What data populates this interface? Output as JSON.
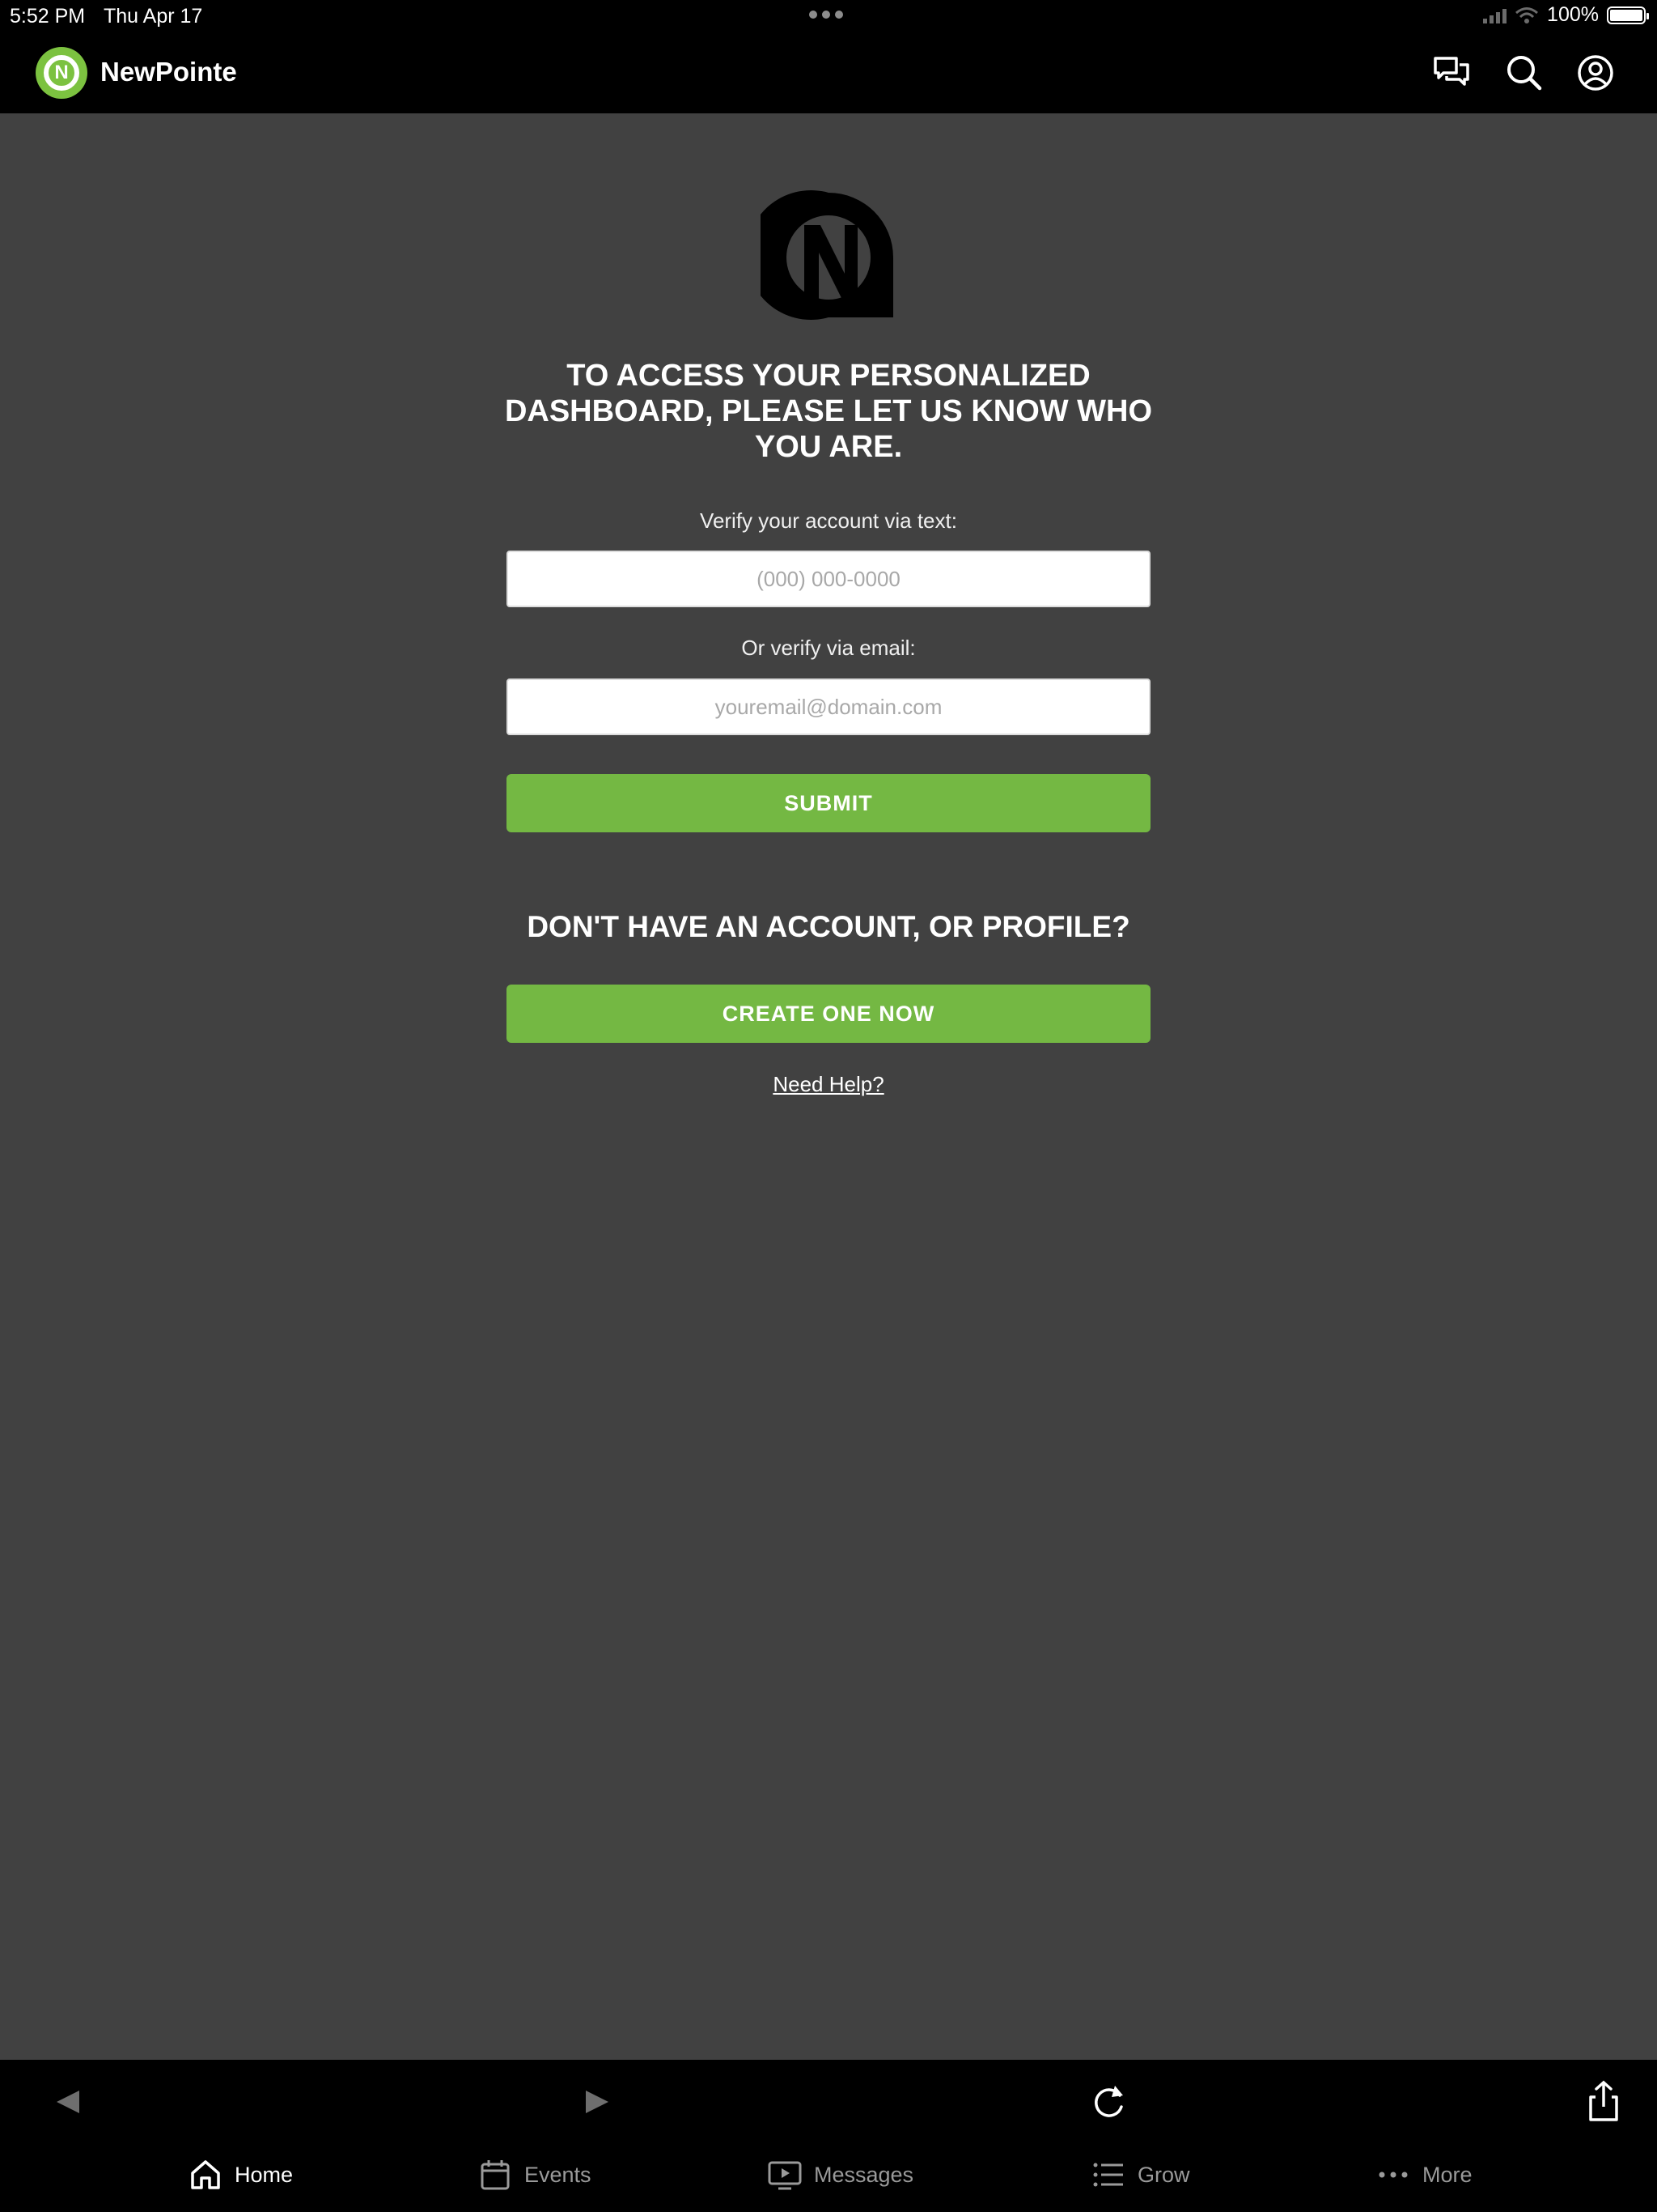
{
  "status_bar": {
    "time": "5:52 PM",
    "date": "Thu Apr 17",
    "battery": "100%"
  },
  "header": {
    "app_name": "NewPointe",
    "logo_letter": "N"
  },
  "main": {
    "headline": "TO ACCESS YOUR PERSONALIZED DASHBOARD, PLEASE LET US KNOW WHO YOU ARE.",
    "phone_label": "Verify your account via text:",
    "phone_placeholder": "(000) 000-0000",
    "email_label": "Or verify via email:",
    "email_placeholder": "youremail@domain.com",
    "submit_label": "SUBMIT",
    "no_account_heading": "DON'T HAVE AN ACCOUNT, OR PROFILE?",
    "create_label": "CREATE ONE NOW",
    "help_link": "Need Help?"
  },
  "bottom_tabs": [
    {
      "label": "Home",
      "icon": "home-icon",
      "active": true
    },
    {
      "label": "Events",
      "icon": "calendar-icon",
      "active": false
    },
    {
      "label": "Messages",
      "icon": "monitor-play-icon",
      "active": false
    },
    {
      "label": "Grow",
      "icon": "list-icon",
      "active": false
    },
    {
      "label": "More",
      "icon": "more-dots-icon",
      "active": false
    }
  ],
  "colors": {
    "accent": "#74b843",
    "brand_green": "#7cc240",
    "background": "#414141",
    "bar": "#000000"
  }
}
